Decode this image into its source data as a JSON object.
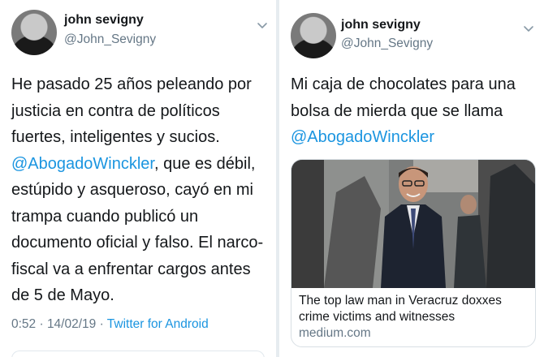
{
  "left_tweet": {
    "author": {
      "name": "john sevigny",
      "handle": "@John_Sevigny"
    },
    "text_before": "He pasado 25 años peleando por justicia en contra de políticos fuertes, inteligentes y sucios. ",
    "mention": "@AbogadoWinckler",
    "text_after": ", que es débil, estúpido y asqueroso, cayó en mi trampa cuando publicó un documento oficial y falso. El narco-fiscal va a enfrentar cargos antes de 5 de Mayo.",
    "timestamp": "0:52 · 14/02/19 · ",
    "source": "Twitter for Android"
  },
  "right_tweet": {
    "author": {
      "name": "john sevigny",
      "handle": "@John_Sevigny"
    },
    "text_before": "Mi caja de chocolates para una bolsa de mierda que se llama ",
    "mention": "@AbogadoWinckler",
    "card": {
      "title": "The top law man in Veracruz doxxes crime victims and witnesses",
      "domain": "medium.com"
    }
  },
  "colors": {
    "link": "#1b95e0",
    "secondary_text": "#657786",
    "primary_text": "#14171a",
    "divider": "#e6ecf0"
  },
  "icons": [
    "chevron-down-icon"
  ]
}
